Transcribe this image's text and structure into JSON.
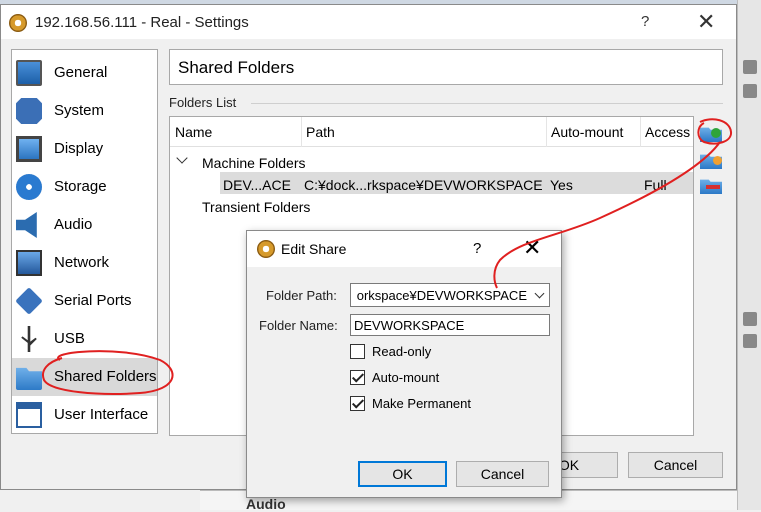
{
  "background": {
    "bottom_item": "Audio"
  },
  "window": {
    "title": "192.168.56.111 - Real - Settings",
    "help": "?",
    "close": "✕"
  },
  "sidebar": {
    "items": [
      {
        "label": "General",
        "icon": "general-icon"
      },
      {
        "label": "System",
        "icon": "system-icon"
      },
      {
        "label": "Display",
        "icon": "display-icon"
      },
      {
        "label": "Storage",
        "icon": "storage-icon"
      },
      {
        "label": "Audio",
        "icon": "audio-icon"
      },
      {
        "label": "Network",
        "icon": "network-icon"
      },
      {
        "label": "Serial Ports",
        "icon": "serial-ports-icon"
      },
      {
        "label": "USB",
        "icon": "usb-icon"
      },
      {
        "label": "Shared Folders",
        "icon": "shared-folders-icon",
        "selected": true
      },
      {
        "label": "User Interface",
        "icon": "user-interface-icon"
      }
    ]
  },
  "section": {
    "title": "Shared Folders",
    "list_label": "Folders List"
  },
  "table": {
    "columns": [
      "Name",
      "Path",
      "Auto-mount",
      "Access"
    ],
    "machine_group": "Machine Folders",
    "transient_group": "Transient Folders",
    "row": {
      "name": "DEV...ACE",
      "path": "C:¥dock...rkspace¥DEVWORKSPACE",
      "auto_mount": "Yes",
      "access": "Full"
    }
  },
  "buttons": {
    "ok": "OK",
    "cancel": "Cancel"
  },
  "dialog": {
    "title": "Edit Share",
    "help": "?",
    "close": "✕",
    "folder_path_label": "Folder Path:",
    "folder_path_value": "C:¥docker¥workspace¥DEVWORKSPACE",
    "folder_path_visible": "orkspace¥DEVWORKSPACE",
    "folder_name_label": "Folder Name:",
    "folder_name_value": "DEVWORKSPACE",
    "read_only": {
      "label": "Read-only",
      "checked": false
    },
    "auto_mount": {
      "label": "Auto-mount",
      "checked": true
    },
    "make_permanent": {
      "label": "Make Permanent",
      "checked": true
    },
    "ok": "OK",
    "cancel": "Cancel"
  },
  "colors": {
    "annotation": "#e02020",
    "selection": "#d9d9d9",
    "focus": "#0078d7"
  }
}
